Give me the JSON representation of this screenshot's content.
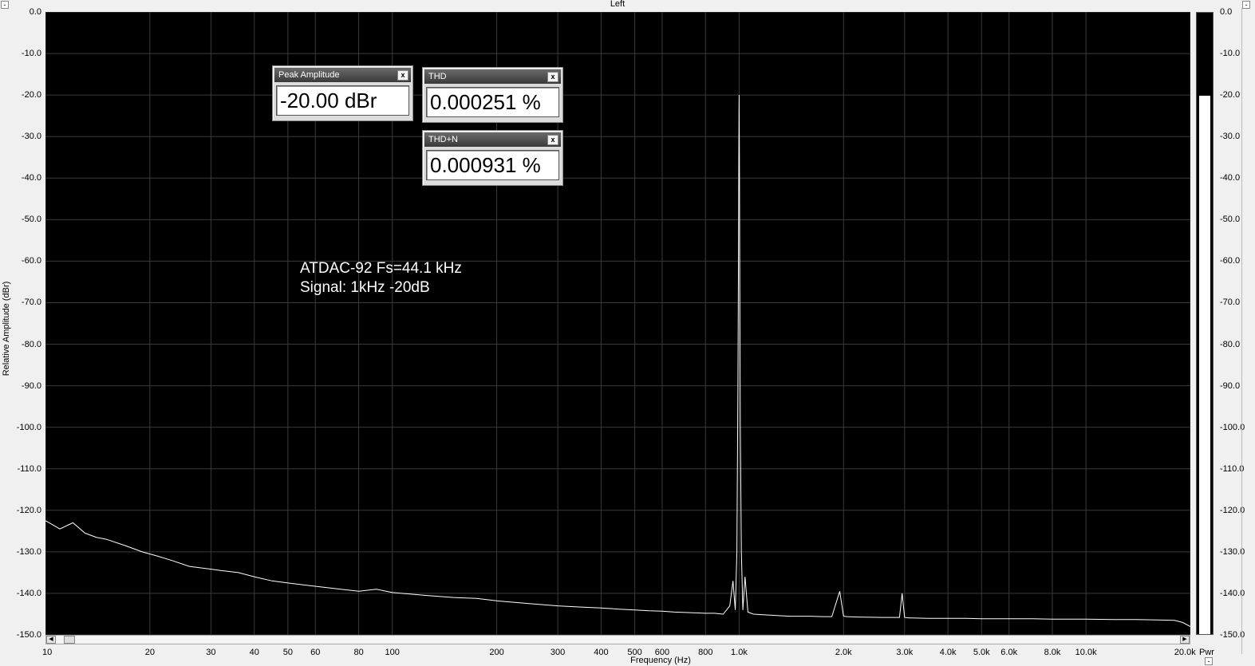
{
  "window": {
    "title": "Left"
  },
  "widgets": {
    "peak_amplitude": {
      "label": "Peak Amplitude",
      "value": "-20.00 dBr"
    },
    "thd": {
      "label": "THD",
      "value": "0.000251 %"
    },
    "thd_n": {
      "label": "THD+N",
      "value": "0.000931 %"
    },
    "close_glyph": "x"
  },
  "meter": {
    "label": "Pwr",
    "level_dbr": -20.0,
    "ylim": [
      -150,
      0
    ]
  },
  "chart_data": {
    "type": "line",
    "title": "Left",
    "xlabel": "Frequency (Hz)",
    "ylabel": "Relative Amplitude (dBr)",
    "xscale": "log",
    "xlim": [
      10,
      20000
    ],
    "ylim": [
      -150,
      0
    ],
    "grid": true,
    "annotation": [
      "ATDAC-92  Fs=44.1 kHz",
      "Signal: 1kHz -20dB"
    ],
    "x_ticks": [
      "10",
      "20",
      "30",
      "40",
      "50",
      "60",
      "80",
      "100",
      "200",
      "300",
      "400",
      "500",
      "600",
      "800",
      "1.0k",
      "2.0k",
      "3.0k",
      "4.0k",
      "5.0k",
      "6.0k",
      "8.0k",
      "10.0k",
      "20.0k"
    ],
    "y_ticks": [
      "0.0",
      "-10.0",
      "-20.0",
      "-30.0",
      "-40.0",
      "-50.0",
      "-60.0",
      "-70.0",
      "-80.0",
      "-90.0",
      "-100.0",
      "-110.0",
      "-120.0",
      "-130.0",
      "-140.0",
      "-150.0"
    ],
    "series": [
      {
        "color": "#ffffff",
        "x": [
          10,
          11,
          12,
          13,
          14,
          15,
          17,
          19,
          21,
          23,
          26,
          29,
          32,
          36,
          40,
          45,
          50,
          56,
          63,
          71,
          80,
          90,
          100,
          125,
          150,
          175,
          200,
          250,
          300,
          350,
          400,
          450,
          500,
          550,
          600,
          650,
          700,
          750,
          800,
          850,
          900,
          940,
          960,
          975,
          985,
          992,
          996,
          998,
          1000,
          1002,
          1004,
          1008,
          1015,
          1025,
          1040,
          1060,
          1100,
          1200,
          1400,
          1600,
          1750,
          1850,
          1950,
          2000,
          2050,
          2200,
          2600,
          2900,
          2950,
          3000,
          3100,
          3500,
          4000,
          4500,
          5000,
          6000,
          7000,
          8000,
          9000,
          10000,
          12000,
          14000,
          16000,
          18000,
          19000,
          20000
        ],
        "y": [
          -122.5,
          -124.5,
          -123.0,
          -125.5,
          -126.5,
          -127.0,
          -128.5,
          -130.0,
          -131.0,
          -132.0,
          -133.5,
          -134.0,
          -134.5,
          -135.0,
          -136.0,
          -137.0,
          -137.5,
          -138.0,
          -138.5,
          -139.0,
          -139.5,
          -139.0,
          -139.8,
          -140.5,
          -141.0,
          -141.2,
          -141.8,
          -142.5,
          -143.0,
          -143.3,
          -143.5,
          -143.8,
          -144.0,
          -144.2,
          -144.3,
          -144.5,
          -144.6,
          -144.7,
          -144.8,
          -144.8,
          -145.0,
          -143.0,
          -137.0,
          -144.0,
          -130.0,
          -90.0,
          -55.0,
          -35.0,
          -20.0,
          -35.0,
          -60.0,
          -100.0,
          -130.0,
          -144.0,
          -136.0,
          -144.5,
          -145.0,
          -145.2,
          -145.5,
          -145.5,
          -145.6,
          -145.6,
          -139.5,
          -145.5,
          -145.6,
          -145.7,
          -145.8,
          -145.8,
          -140.0,
          -145.8,
          -145.9,
          -146.0,
          -146.0,
          -146.0,
          -146.1,
          -146.1,
          -146.1,
          -146.2,
          -146.2,
          -146.2,
          -146.3,
          -146.3,
          -146.4,
          -146.5,
          -147.0,
          -148.0
        ]
      }
    ]
  }
}
